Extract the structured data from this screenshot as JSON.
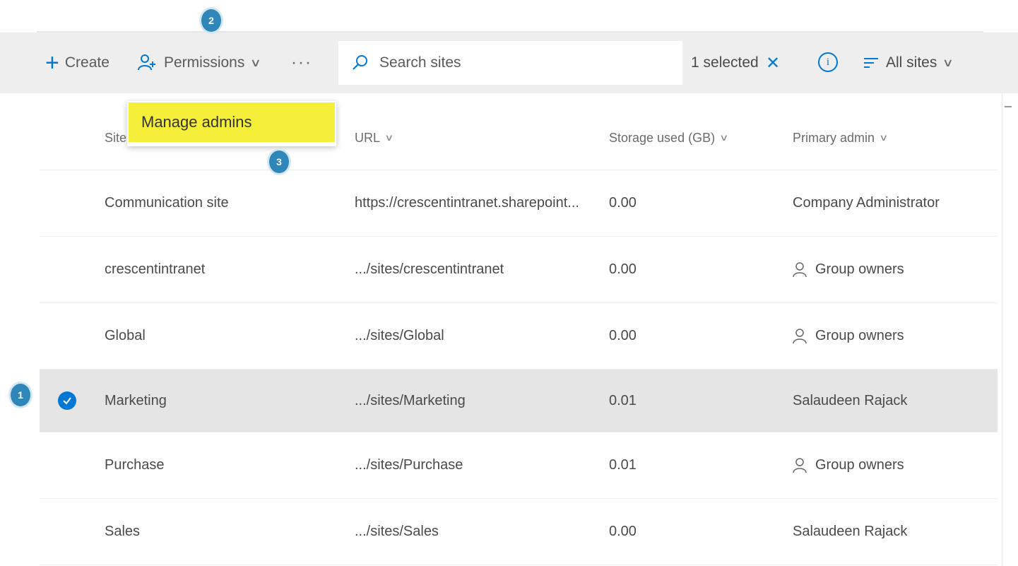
{
  "toolbar": {
    "create_label": "Create",
    "permissions_label": "Permissions",
    "more_label": "···",
    "search_placeholder": "Search sites",
    "selected_text": "1 selected",
    "clear_label": "✕",
    "info_label": "i",
    "view_label": "All sites"
  },
  "menu": {
    "manage_admins_label": "Manage admins"
  },
  "badges": {
    "step1": "1",
    "step2": "2",
    "step3": "3"
  },
  "table": {
    "headers": {
      "site_name": "Site name ↑",
      "url": "URL",
      "storage": "Storage used (GB)",
      "admin": "Primary admin"
    },
    "rows": [
      {
        "name": "Communication site",
        "url": "https://crescentintranet.sharepoint...",
        "storage": "0.00",
        "admin": "Company Administrator",
        "group": false
      },
      {
        "name": "crescentintranet",
        "url": ".../sites/crescentintranet",
        "storage": "0.00",
        "admin": "Group owners",
        "group": true
      },
      {
        "name": "Global",
        "url": ".../sites/Global",
        "storage": "0.00",
        "admin": "Group owners",
        "group": true
      },
      {
        "name": "Marketing",
        "url": ".../sites/Marketing",
        "storage": "0.01",
        "admin": "Salaudeen Rajack",
        "group": false
      },
      {
        "name": "Purchase",
        "url": ".../sites/Purchase",
        "storage": "0.01",
        "admin": "Group owners",
        "group": true
      },
      {
        "name": "Sales",
        "url": ".../sites/Sales",
        "storage": "0.00",
        "admin": "Salaudeen Rajack",
        "group": false
      }
    ]
  },
  "colors": {
    "accent": "#0078d4",
    "highlight": "#f5ef3a",
    "badge": "#2f86b8",
    "selected_row": "#e5e5e5"
  },
  "icons": {
    "create": "plus-icon",
    "permissions": "permissions-icon",
    "search": "search-icon",
    "info": "info-icon",
    "view": "filter-icon",
    "group": "person-icon",
    "selection": "checkmark-icon"
  }
}
